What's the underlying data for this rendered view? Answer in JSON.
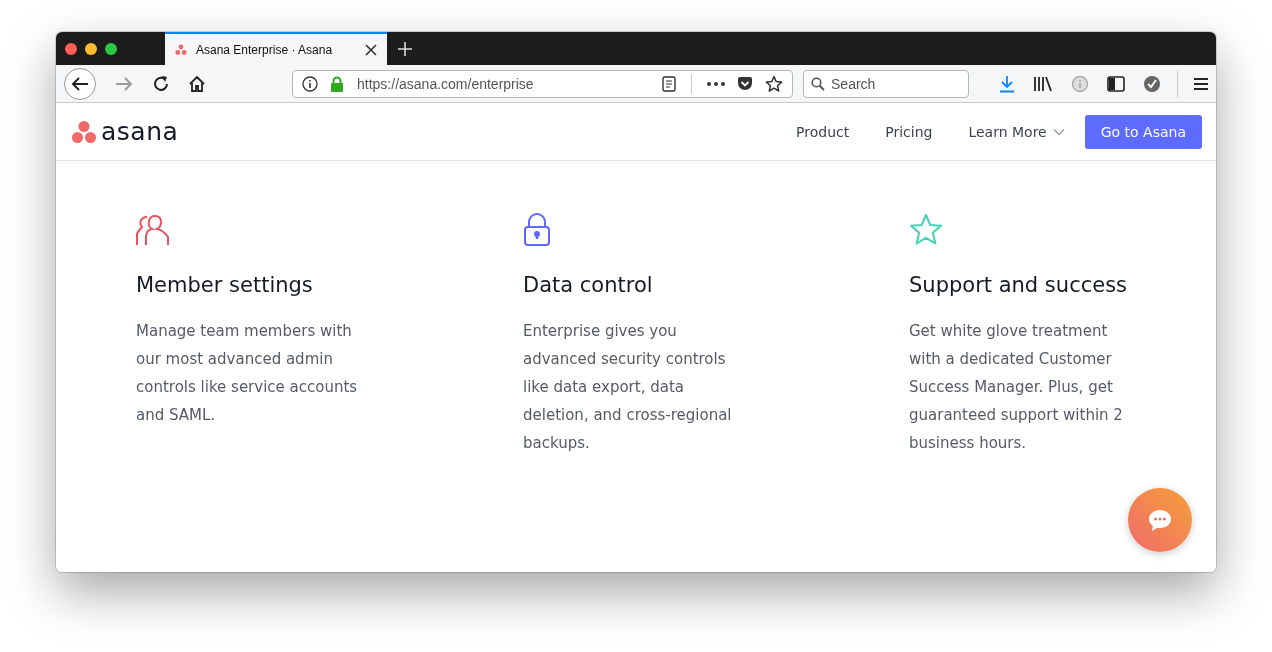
{
  "browser": {
    "tabs": [
      {
        "title": "Asana Enterprise · Asana",
        "selected": true
      }
    ],
    "url": {
      "host": "https://asana.com",
      "path": "/enterprise"
    },
    "search": {
      "placeholder": "Search"
    }
  },
  "nav": {
    "logo": "asana",
    "links": [
      {
        "label": "Product",
        "kind": "link"
      },
      {
        "label": "Pricing",
        "kind": "link"
      },
      {
        "label": "Learn More",
        "kind": "dropdown"
      }
    ],
    "cta": "Go to Asana"
  },
  "features": [
    {
      "kind": "people",
      "color": "#e8545d",
      "title": "Member settings",
      "text": "Manage team members with our most advanced admin controls like service accounts and SAML."
    },
    {
      "kind": "lock",
      "color": "#6068f5",
      "title": "Data control",
      "text": "Enterprise gives you advanced security controls like data export, data deletion, and cross-regional backups."
    },
    {
      "kind": "star",
      "color": "#43d3b4",
      "title": "Support and success",
      "text": "Get white glove treatment with a dedicated Customer Success Manager. Plus, get guaranteed support within 2 business hours."
    }
  ]
}
